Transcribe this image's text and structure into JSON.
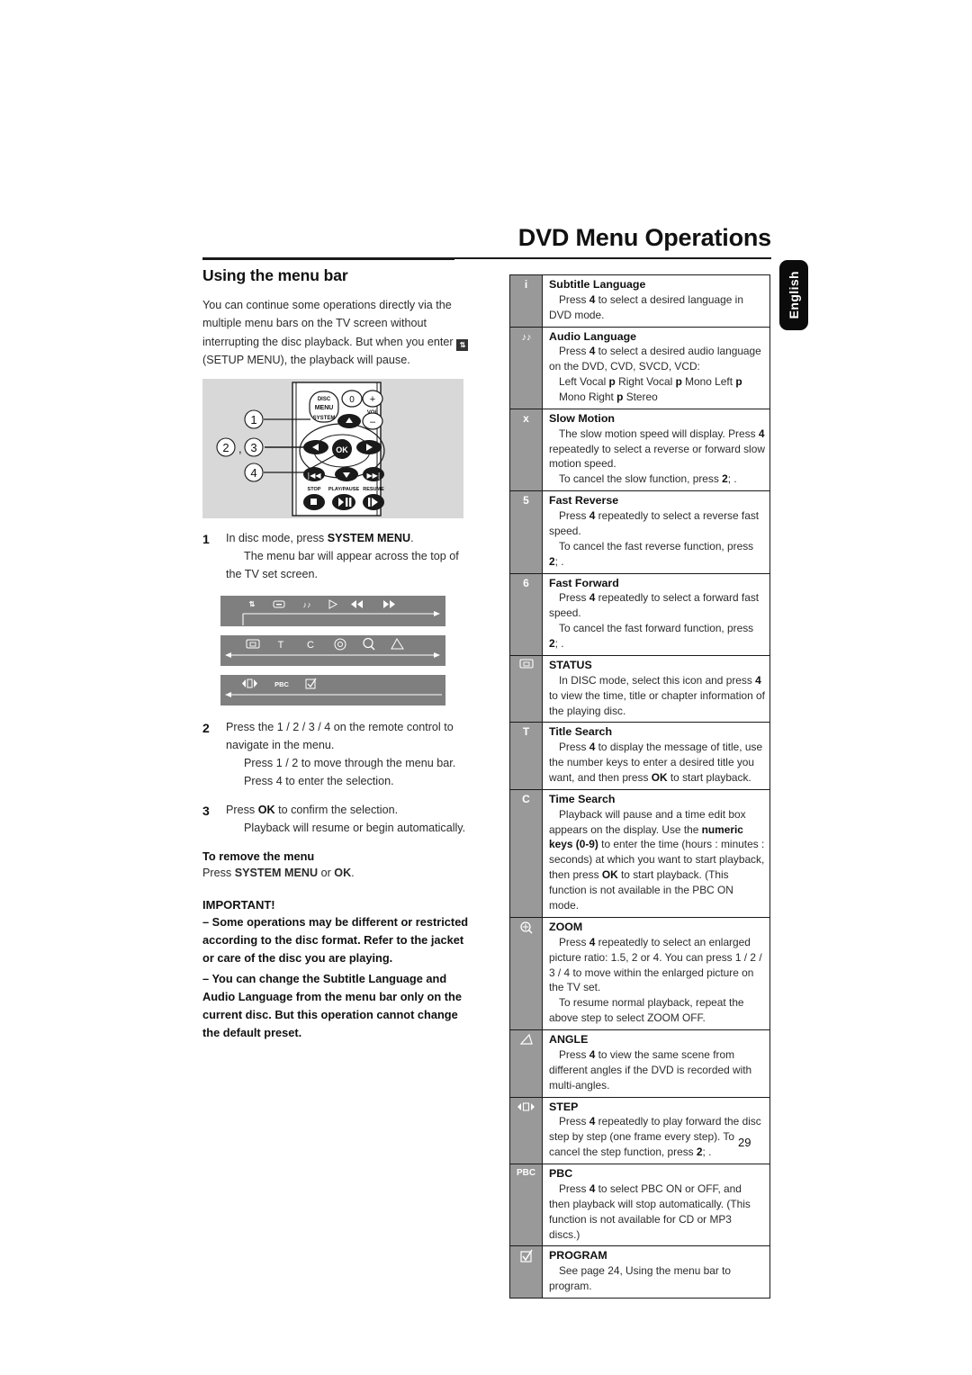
{
  "header": {
    "title": "DVD Menu Operations",
    "language_tab": "English"
  },
  "left_column": {
    "section_title": "Using the menu bar",
    "intro_part1": "You can continue some operations directly via the multiple menu bars on the TV screen without interrupting the disc playback. But when you enter",
    "intro_icon": "setup-menu-icon",
    "intro_part2": "(SETUP MENU), the playback will pause.",
    "figure": {
      "name": "remote-control-illustration",
      "callouts": [
        "1",
        "2 ,3",
        "4"
      ],
      "buttons": [
        "DISC",
        "MENU",
        "SYSTEM",
        "0",
        "+",
        "VOL",
        "–",
        "OK",
        "STOP",
        "PLAY/PAUSE",
        "RESUME"
      ]
    },
    "steps": [
      {
        "num": "1",
        "line1_pre": "In disc mode, press ",
        "line1_bold": "SYSTEM MENU",
        "line1_post": ".",
        "line2": "The menu bar will appear across the top of the TV set screen."
      },
      {
        "num": "2",
        "line1": "Press the 1  / 2  / 3  / 4  on the remote control to navigate in the menu.",
        "line2": "Press 1  / 2  to move through the menu bar.",
        "line3": "Press 4  to enter the selection."
      },
      {
        "num": "3",
        "line1_pre": "Press ",
        "line1_bold": "OK",
        "line1_post": " to confirm the selection.",
        "line2": "Playback will resume or begin automatically."
      }
    ],
    "menu_bars": [
      {
        "name": "menu-bar-row-1",
        "icons": [
          "setup",
          "subtitle",
          "audio",
          "play",
          "fast-reverse",
          "fast-forward"
        ]
      },
      {
        "name": "menu-bar-row-2",
        "icons": [
          "status",
          "title-search",
          "time-search",
          "disc-menu",
          "zoom",
          "angle"
        ]
      },
      {
        "name": "menu-bar-row-3",
        "icons": [
          "step",
          "pbc",
          "program"
        ]
      }
    ],
    "remove_menu": {
      "heading": "To remove the menu",
      "line_pre": "Press ",
      "line_bold1": "SYSTEM MENU",
      "line_mid": " or ",
      "line_bold2": "OK",
      "line_post": "."
    },
    "important": {
      "heading": "IMPORTANT!",
      "bullets": [
        "–  Some operations may be different or restricted according to the disc format. Refer to the jacket or care of the disc you are playing.",
        "–  You can change the Subtitle Language and Audio Language from the menu bar only on the current disc. But this operation cannot change the default preset."
      ]
    }
  },
  "table": {
    "name": "menu-bar-functions-table",
    "rows": [
      {
        "icon_glyph": "i",
        "icon_type": "text",
        "title": "Subtitle Language",
        "lines": [
          "Press 4  to select a desired language in DVD mode."
        ]
      },
      {
        "icon_glyph": "♪♪",
        "icon_type": "audio",
        "title": "Audio Language",
        "lines": [
          "Press 4  to select a desired audio language on the DVD, CVD, SVCD, VCD:",
          "Left Vocal p   Right Vocal p   Mono Left p",
          "Mono Right p   Stereo"
        ]
      },
      {
        "icon_glyph": "x",
        "icon_type": "text",
        "title": "Slow Motion",
        "lines": [
          "The slow motion speed will display. Press 4 repeatedly to select a reverse or forward slow motion speed.",
          "To cancel the slow function, press 2; ."
        ]
      },
      {
        "icon_glyph": "5",
        "icon_type": "text",
        "title": "Fast Reverse",
        "lines": [
          "Press 4  repeatedly to select a reverse fast speed.",
          "To cancel the fast reverse function, press 2; ."
        ]
      },
      {
        "icon_glyph": "6",
        "icon_type": "text",
        "title": "Fast Forward",
        "lines": [
          "Press 4  repeatedly to select a forward fast speed.",
          "To cancel the fast forward function, press 2; ."
        ]
      },
      {
        "icon_glyph": "▭",
        "icon_type": "boxed",
        "title": "STATUS",
        "lines": [
          "In DISC mode, select this icon and press 4  to view the time, title or chapter information of the playing disc."
        ]
      },
      {
        "icon_glyph": "T",
        "icon_type": "text",
        "title": "Title Search",
        "lines": [
          "Press 4  to display the message of title, use the number keys to enter a desired title you want, and then press OK to start playback."
        ]
      },
      {
        "icon_glyph": "C",
        "icon_type": "text",
        "title": "Time Search",
        "lines": [
          "Playback will pause and a time edit box appears on the display. Use the numeric keys (0-9) to enter the time (hours : minutes : seconds) at which you want to start playback, then press OK to start playback. (This function is not available in the PBC ON mode."
        ]
      },
      {
        "icon_glyph": "⊕",
        "icon_type": "zoom",
        "title": "ZOOM",
        "lines": [
          "Press 4  repeatedly to select an enlarged picture ratio: 1.5, 2 or 4. You can press 1  / 2  / 3  / 4  to move within the enlarged picture on the TV set.",
          "To resume normal playback, repeat the above step to select ZOOM OFF."
        ]
      },
      {
        "icon_glyph": "◸",
        "icon_type": "angle",
        "title": "ANGLE",
        "lines": [
          "Press 4  to view the same scene from different angles  if the DVD is recorded with multi-angles."
        ]
      },
      {
        "icon_glyph": "◀▶",
        "icon_type": "step",
        "title": "STEP",
        "lines": [
          "Press 4  repeatedly to play forward the disc step by step (one frame every step). To cancel the step function, press 2; ."
        ]
      },
      {
        "icon_glyph": "PBC",
        "icon_type": "text-small",
        "title": "PBC",
        "lines": [
          "Press 4  to select PBC ON or OFF, and then playback will stop automatically. (This function is not available for CD or MP3 discs.)"
        ]
      },
      {
        "icon_glyph": "☑",
        "icon_type": "program",
        "title": "PROGRAM",
        "lines": [
          "See page 24, Using the menu bar to program."
        ]
      }
    ]
  },
  "footer": {
    "page_number": "29"
  }
}
